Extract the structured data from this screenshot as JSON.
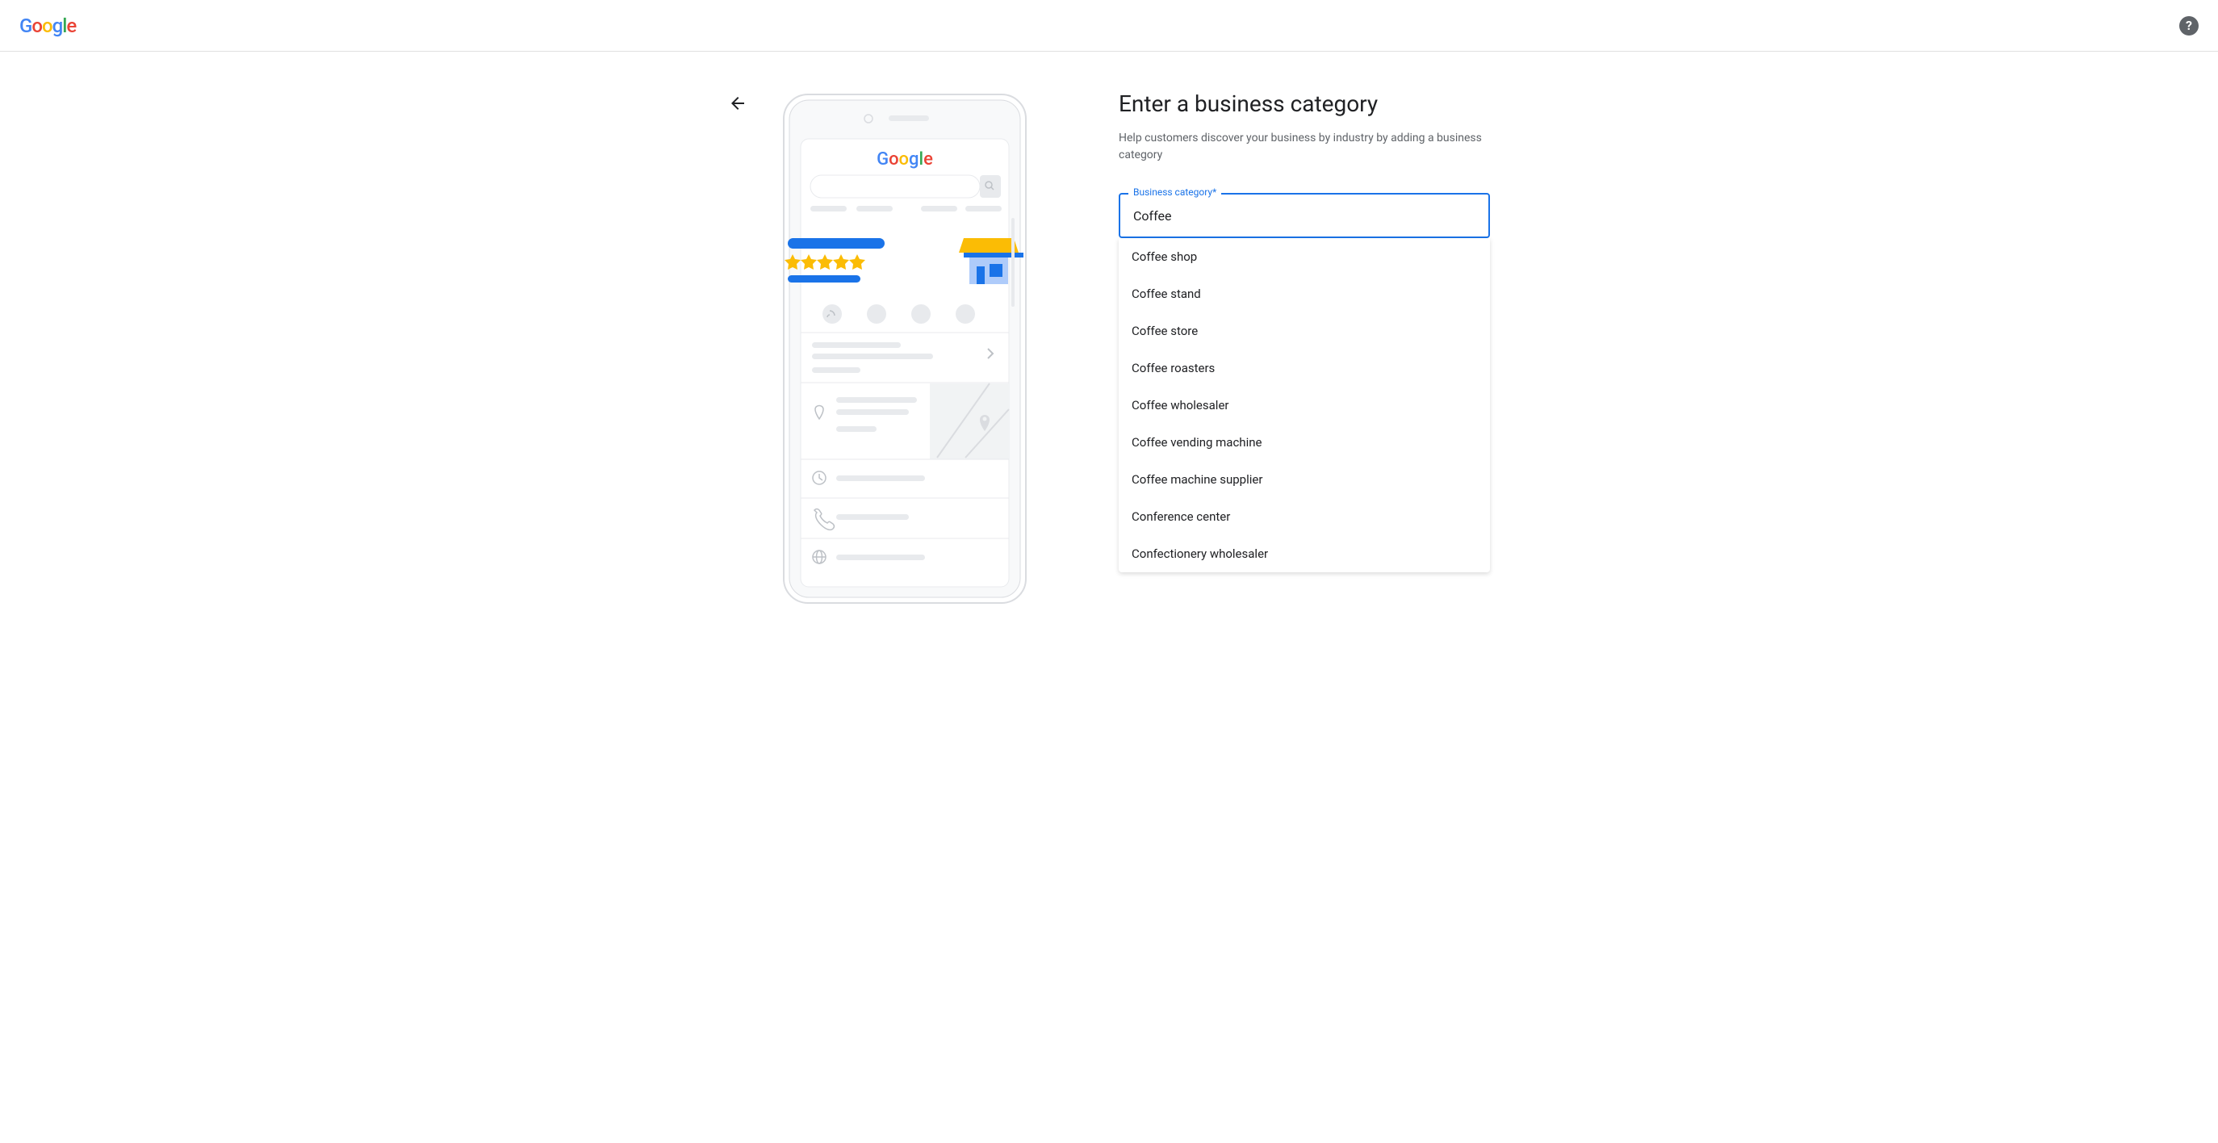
{
  "header": {
    "logo": "Google"
  },
  "title": "Enter a business category",
  "subtitle": "Help customers discover your business by industry by adding a business category",
  "input": {
    "label": "Business category*",
    "value": "Coffee"
  },
  "dropdown": {
    "items": [
      "Coffee shop",
      "Coffee stand",
      "Coffee store",
      "Coffee roasters",
      "Coffee wholesaler",
      "Coffee vending machine",
      "Coffee machine supplier",
      "Conference center",
      "Confectionery wholesaler"
    ]
  },
  "illustration": {
    "google": "Google"
  }
}
